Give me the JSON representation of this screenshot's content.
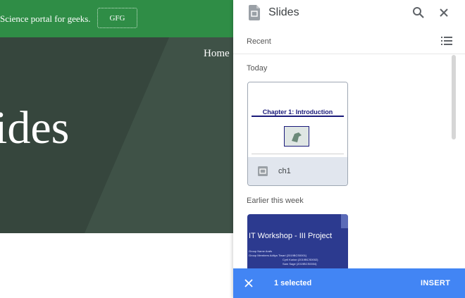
{
  "site": {
    "tagline": "Science portal for geeks.",
    "gfg_button": "GFG",
    "home_link": "Home",
    "hero_title": "ides",
    "colors": {
      "brand_green": "#2f8d46",
      "hero_dark": "#36463d"
    }
  },
  "picker": {
    "title": "Slides",
    "icons": {
      "logo": "slides-icon",
      "search": "search-icon",
      "close": "close-icon",
      "view": "list-view-icon"
    },
    "recent_label": "Recent",
    "sections": [
      {
        "label": "Today",
        "files": [
          {
            "name": "ch1",
            "thumbnail_title": "Chapter 1:  Introduction"
          }
        ]
      },
      {
        "label": "Earlier this week",
        "files": [
          {
            "thumbnail_title": "IT Workshop - III Project",
            "lines": [
              "Group Name    Arafs",
              "Group Members  Aditya Tiwari (2019BCS0001)",
              "Cyril Kurian (2019BCS0002)",
              "Sam Sage (2019BCS0004)"
            ]
          }
        ]
      }
    ]
  },
  "action_bar": {
    "selected_text": "1 selected",
    "insert_label": "INSERT",
    "color": "#4285f4"
  }
}
